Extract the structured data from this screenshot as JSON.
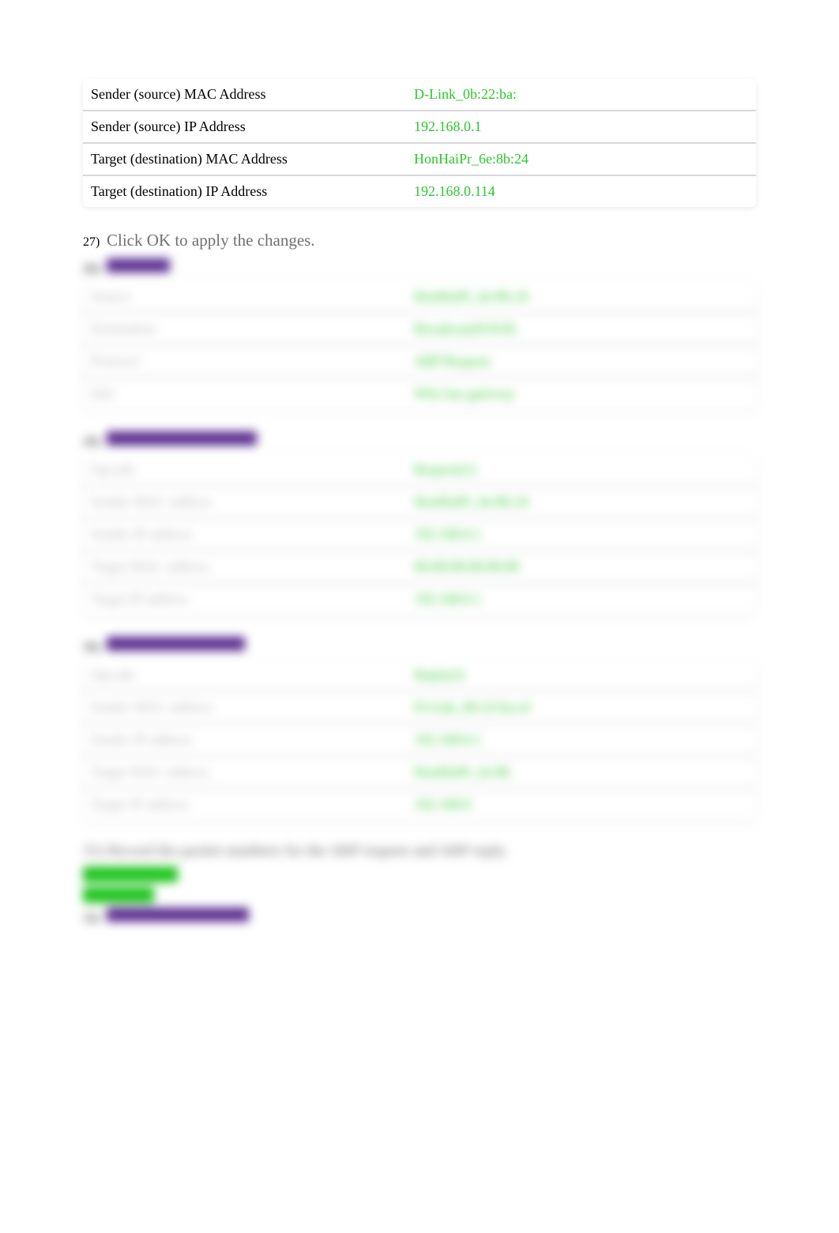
{
  "table1": {
    "rows": [
      {
        "label": "Sender (source) MAC Address",
        "value": "D-Link_0b:22:ba:"
      },
      {
        "label": "Sender (source) IP Address",
        "value": "192.168.0.1"
      },
      {
        "label": "Target (destination) MAC Address",
        "value": "HonHaiPr_6e:8b:24"
      },
      {
        "label": "Target (destination) IP Address",
        "value": "192.168.0.114"
      }
    ]
  },
  "step27": {
    "num": "27)",
    "text": "Click OK to apply the changes."
  },
  "blurred_section_a": {
    "num": "28)",
    "heading_width": 80,
    "rows": [
      {
        "label": "Source",
        "value": "HonHaiPr_6e:8b:24"
      },
      {
        "label": "Destination",
        "value": "Broadcast(ff:ff:ff)"
      },
      {
        "label": "Protocol",
        "value": "ARP Request"
      },
      {
        "label": "Info",
        "value": "Who has gateway"
      }
    ]
  },
  "blurred_section_b": {
    "num": "29)",
    "heading_width": 190,
    "rows": [
      {
        "label": "Opcode",
        "value": "Request(1)"
      },
      {
        "label": "Sender MAC address",
        "value": "HonHaiPr_6e:8b:24"
      },
      {
        "label": "Sender IP address",
        "value": "192.168.0.1"
      },
      {
        "label": "Target MAC address",
        "value": "00:00:00:00:00:00"
      },
      {
        "label": "Target IP address",
        "value": "192.168.0.1"
      }
    ]
  },
  "blurred_section_c": {
    "num": "30)",
    "heading_width": 175,
    "rows": [
      {
        "label": "Opcode",
        "value": "Reply(2)"
      },
      {
        "label": "Sender MAC address",
        "value": "D-Link_0b:22:ba:cd"
      },
      {
        "label": "Sender IP address",
        "value": "192.168.0.1"
      },
      {
        "label": "Target MAC address",
        "value": "HonHaiPr_6e:8b"
      },
      {
        "label": "Target IP address",
        "value": "192.168.0"
      }
    ]
  },
  "blurred_footer": {
    "text_line": "31) Record the packet numbers for the ARP request and ARP reply.",
    "highlight1_width": 120,
    "highlight1_label": "ARP request: 35",
    "highlight2_width": 90,
    "highlight2_label": "ARP reply: 40",
    "purple_width": 180,
    "purple_num": "32)"
  }
}
